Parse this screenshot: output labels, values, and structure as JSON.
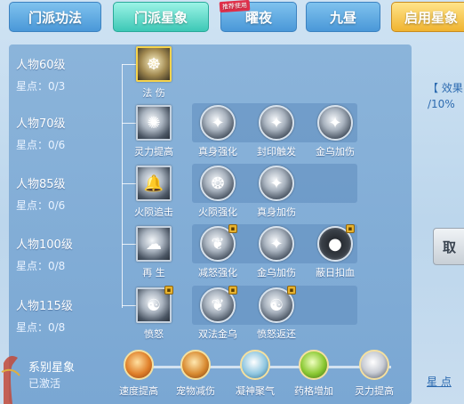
{
  "tabs": [
    {
      "label": "门派功法"
    },
    {
      "label": "门派星象"
    },
    {
      "label": "曜夜",
      "badge": "推荐使用"
    },
    {
      "label": "九昼"
    },
    {
      "label": "启用星象"
    }
  ],
  "rows": [
    {
      "level": "人物60级",
      "points": "星点：0/3",
      "skills": [
        {
          "label": "法 伤",
          "icon": "meditate-icon"
        }
      ]
    },
    {
      "level": "人物70级",
      "points": "星点：0/6",
      "skills": [
        {
          "label": "灵力提高",
          "icon": "burst-icon"
        },
        {
          "label": "真身强化",
          "icon": "phoenix-icon"
        },
        {
          "label": "封印触发",
          "icon": "phoenix-icon"
        },
        {
          "label": "金乌加伤",
          "icon": "phoenix-icon"
        }
      ]
    },
    {
      "level": "人物85级",
      "points": "星点：0/6",
      "skills": [
        {
          "label": "火陨追击",
          "icon": "bell-icon"
        },
        {
          "label": "火陨强化",
          "icon": "swirl-icon"
        },
        {
          "label": "真身加伤",
          "icon": "phoenix-icon"
        }
      ]
    },
    {
      "level": "人物100级",
      "points": "星点：0/8",
      "skills": [
        {
          "label": "再 生",
          "icon": "cloud-icon"
        },
        {
          "label": "减怒强化",
          "icon": "wing-icon"
        },
        {
          "label": "金乌加伤",
          "icon": "phoenix-icon"
        },
        {
          "label": "蔽日扣血",
          "icon": "dark-orb-icon"
        }
      ]
    },
    {
      "level": "人物115级",
      "points": "星点：0/8",
      "skills": [
        {
          "label": "愤怒",
          "icon": "figure-icon"
        },
        {
          "label": "双法金乌",
          "icon": "wing-icon"
        },
        {
          "label": "愤怒返还",
          "icon": "figure-icon"
        }
      ]
    }
  ],
  "series": {
    "title": "系别星象",
    "status": "已激活",
    "items": [
      {
        "label": "速度提高",
        "color": "#e0802a"
      },
      {
        "label": "宠物减伤",
        "color": "#d88a30"
      },
      {
        "label": "凝神聚气",
        "color": "#8fc6e0"
      },
      {
        "label": "药格增加",
        "color": "#8ac832"
      },
      {
        "label": "灵力提高",
        "color": "#c8ccd4"
      }
    ]
  },
  "right": {
    "effect_label": "【 效果",
    "percent": "/10%",
    "button_label": "取",
    "star_label": "星 点"
  }
}
